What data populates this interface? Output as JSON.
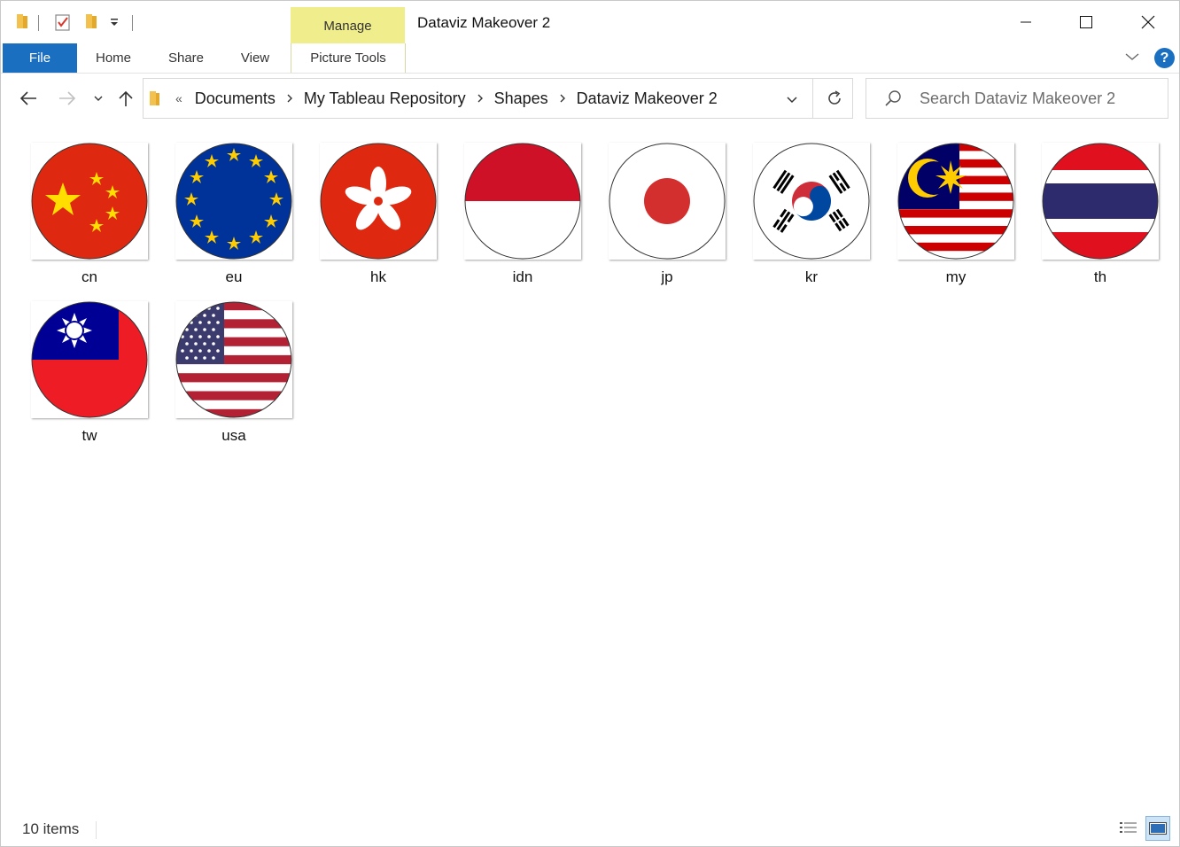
{
  "window": {
    "title": "Dataviz Makeover 2",
    "context_tab_group": "Manage"
  },
  "ribbon": {
    "tabs": [
      "File",
      "Home",
      "Share",
      "View",
      "Picture Tools"
    ]
  },
  "navigation": {
    "breadcrumb_overflow": "«",
    "breadcrumbs": [
      "Documents",
      "My Tableau Repository",
      "Shapes",
      "Dataviz Makeover 2"
    ],
    "search_placeholder": "Search Dataviz Makeover 2"
  },
  "files": [
    {
      "name": "cn",
      "flag": "china-flag-icon"
    },
    {
      "name": "eu",
      "flag": "eu-flag-icon"
    },
    {
      "name": "hk",
      "flag": "hong-kong-flag-icon"
    },
    {
      "name": "idn",
      "flag": "indonesia-flag-icon"
    },
    {
      "name": "jp",
      "flag": "japan-flag-icon"
    },
    {
      "name": "kr",
      "flag": "south-korea-flag-icon"
    },
    {
      "name": "my",
      "flag": "malaysia-flag-icon"
    },
    {
      "name": "th",
      "flag": "thailand-flag-icon"
    },
    {
      "name": "tw",
      "flag": "taiwan-flag-icon"
    },
    {
      "name": "usa",
      "flag": "usa-flag-icon"
    }
  ],
  "status": {
    "item_count": "10 items"
  },
  "colors": {
    "file_tab": "#1a6fc1",
    "manage_tab": "#f0ee8c"
  }
}
